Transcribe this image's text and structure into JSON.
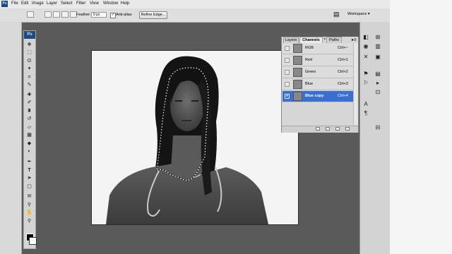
{
  "menu": [
    "File",
    "Edit",
    "Image",
    "Layer",
    "Select",
    "Filter",
    "View",
    "Window",
    "Help"
  ],
  "app_logo": "Ps",
  "options_bar": {
    "feather_label": "Feather:",
    "feather_value": "0 px",
    "antialias_label": "Anti-alias",
    "antialias_checked": true,
    "refine_edge_label": "Refine Edge...",
    "workspace_label": "Workspace ▾"
  },
  "panel": {
    "tabs": [
      "Layers",
      "Channels",
      "Paths"
    ],
    "active_tab": "Channels",
    "channels": [
      {
        "name": "RGB",
        "shortcut": "Ctrl+~",
        "selected": false
      },
      {
        "name": "Red",
        "shortcut": "Ctrl+1",
        "selected": false
      },
      {
        "name": "Green",
        "shortcut": "Ctrl+2",
        "selected": false
      },
      {
        "name": "Blue",
        "shortcut": "Ctrl+3",
        "selected": false
      },
      {
        "name": "Blue copy",
        "shortcut": "Ctrl+4",
        "selected": true
      }
    ]
  },
  "colors": {
    "selected_channel": "#3a6fd0",
    "workspace_bg": "#5a5a5a",
    "chrome": "#dedede",
    "brand": "#1f4a7e"
  },
  "canvas": {
    "content": "grayscale photo of a woman in scrubs with stethoscope",
    "selection": "marching-ants outline around hair",
    "color_mode": "grayscale channel view"
  },
  "tools": [
    "move-tool-icon",
    "marquee-tool-icon",
    "lasso-tool-icon",
    "magic-wand-tool-icon",
    "crop-tool-icon",
    "eyedropper-tool-icon",
    "healing-brush-tool-icon",
    "brush-tool-icon",
    "clone-stamp-tool-icon",
    "history-brush-tool-icon",
    "eraser-tool-icon",
    "gradient-tool-icon",
    "blur-tool-icon",
    "dodge-tool-icon",
    "pen-tool-icon",
    "type-tool-icon",
    "path-selection-tool-icon",
    "shape-tool-icon",
    "notes-tool-icon",
    "hand-tool-icon",
    "zoom-tool-icon"
  ],
  "dock_icons": [
    "layers-dock-icon",
    "channels-dock-icon",
    "navigator-dock-icon",
    "histogram-dock-icon",
    "info-dock-icon",
    "color-dock-icon",
    "swatches-dock-icon",
    "styles-dock-icon",
    "history-dock-icon",
    "actions-dock-icon",
    "brushes-dock-icon",
    "tool-presets-dock-icon",
    "character-dock-icon",
    "paragraph-dock-icon",
    "clone-source-dock-icon"
  ]
}
